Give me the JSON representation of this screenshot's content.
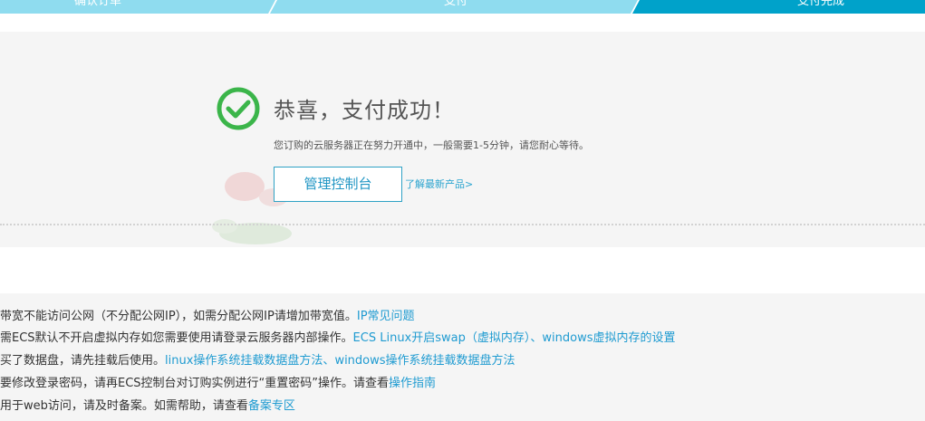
{
  "steps": [
    {
      "label": "确认订单",
      "state": "done"
    },
    {
      "label": "支付",
      "state": "done"
    },
    {
      "label": "支付完成",
      "state": "active"
    }
  ],
  "colors": {
    "step_done": "#8fdcef",
    "step_active": "#00a2ca",
    "accent": "#2196c4",
    "success_green": "#3bb54a",
    "panel_bg": "#f5f5f5",
    "link": "#1f9bd1"
  },
  "success": {
    "icon": "check-circle-icon",
    "title": "恭喜，支付成功！",
    "subtitle": "您订购的云服务器正在努力开通中，一般需要1-5分钟，请您耐心等待。",
    "console_button": "管理控制台",
    "products_link": "了解最新产品>"
  },
  "notes": [
    {
      "text": "带宽不能访问公网（不分配公网IP），如需分配公网IP请增加带宽值。",
      "links": [
        "IP常见问题"
      ]
    },
    {
      "text": "需ECS默认不开启虚拟内存如您需要使用请登录云服务器内部操作。",
      "links": [
        "ECS Linux开启swap（虚拟内存）",
        "、",
        "windows虚拟内存的设置"
      ]
    },
    {
      "text": "买了数据盘，请先挂载后使用。",
      "links": [
        "linux操作系统挂载数据盘方法",
        "、",
        "windows操作系统挂载数据盘方法"
      ]
    },
    {
      "text": "要修改登录密码，请再ECS控制台对订购实例进行“重置密码”操作。请查看",
      "links": [
        "操作指南"
      ]
    },
    {
      "text": "用于web访问，请及时备案。如需帮助，请查看",
      "links": [
        "备案专区"
      ]
    }
  ]
}
